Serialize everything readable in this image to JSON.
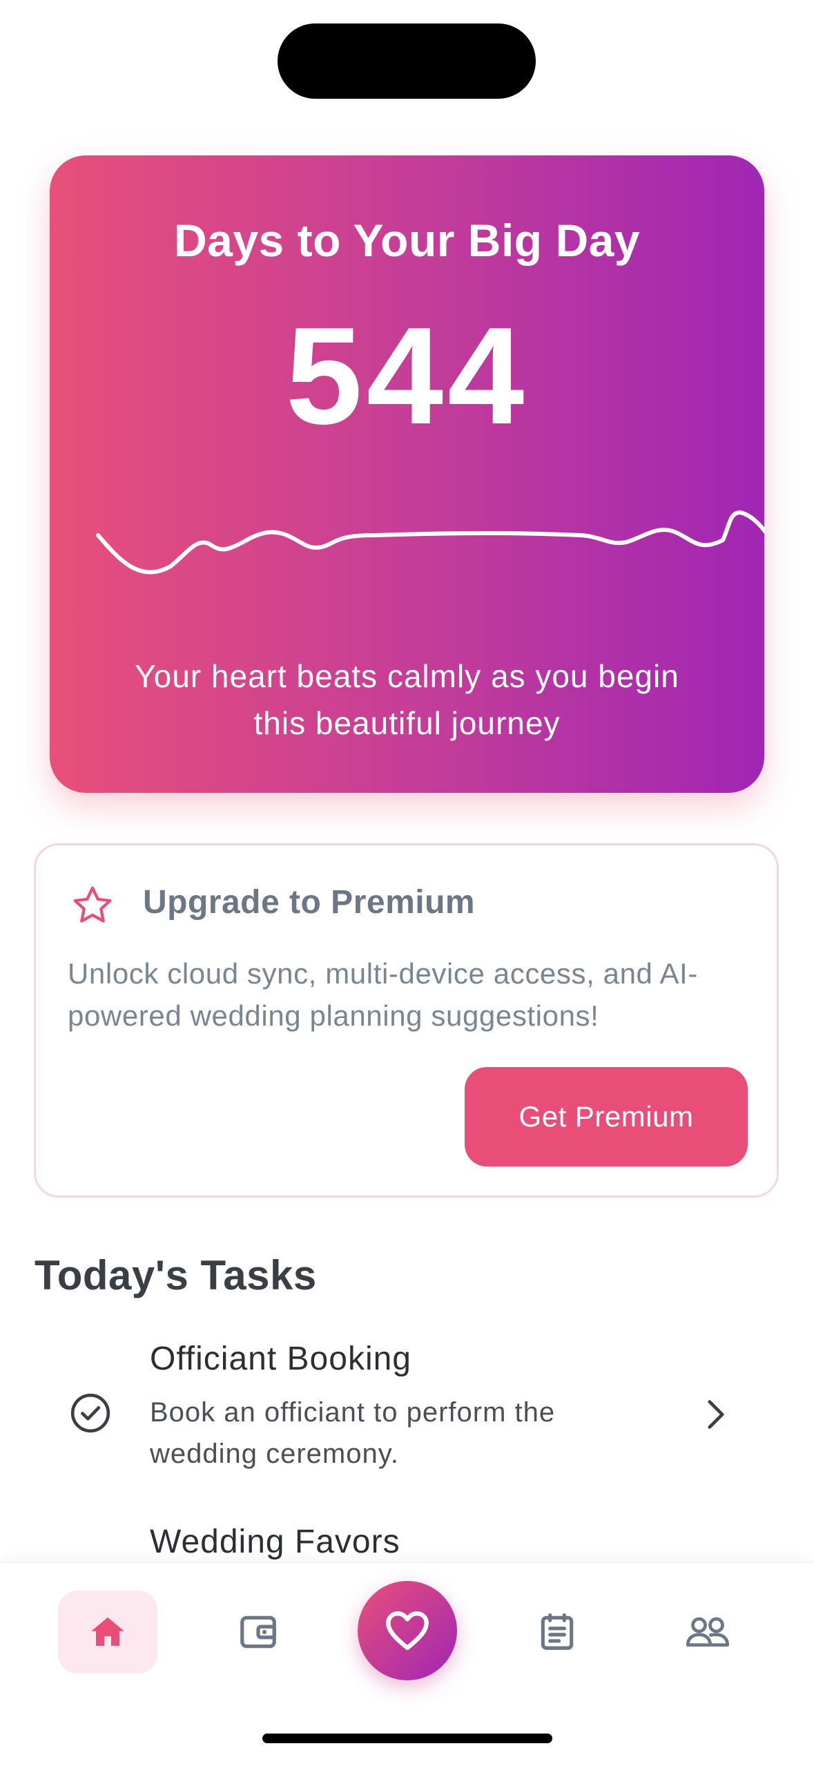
{
  "countdown": {
    "title": "Days to Your Big Day",
    "days": "544",
    "message": "Your heart beats calmly as you begin this beautiful journey"
  },
  "premium": {
    "icon": "star-icon",
    "title": "Upgrade to Premium",
    "description": "Unlock cloud sync, multi-device access, and AI-powered wedding planning suggestions!",
    "button_label": "Get Premium"
  },
  "tasks": {
    "section_title": "Today's Tasks",
    "items": [
      {
        "title": "Officiant Booking",
        "description": "Book an officiant to perform the wedding ceremony.",
        "icon": "check-circle-icon"
      },
      {
        "title": "Wedding Favors"
      }
    ]
  },
  "nav": {
    "items": [
      {
        "icon": "home-icon",
        "active": true
      },
      {
        "icon": "wallet-icon",
        "active": false
      },
      {
        "icon": "heart-icon",
        "active": false
      },
      {
        "icon": "notes-icon",
        "active": false
      },
      {
        "icon": "guests-icon",
        "active": false
      }
    ]
  },
  "colors": {
    "accent": "#E84E78",
    "gradient_end": "#A026B4",
    "text_muted": "#6B7785"
  }
}
